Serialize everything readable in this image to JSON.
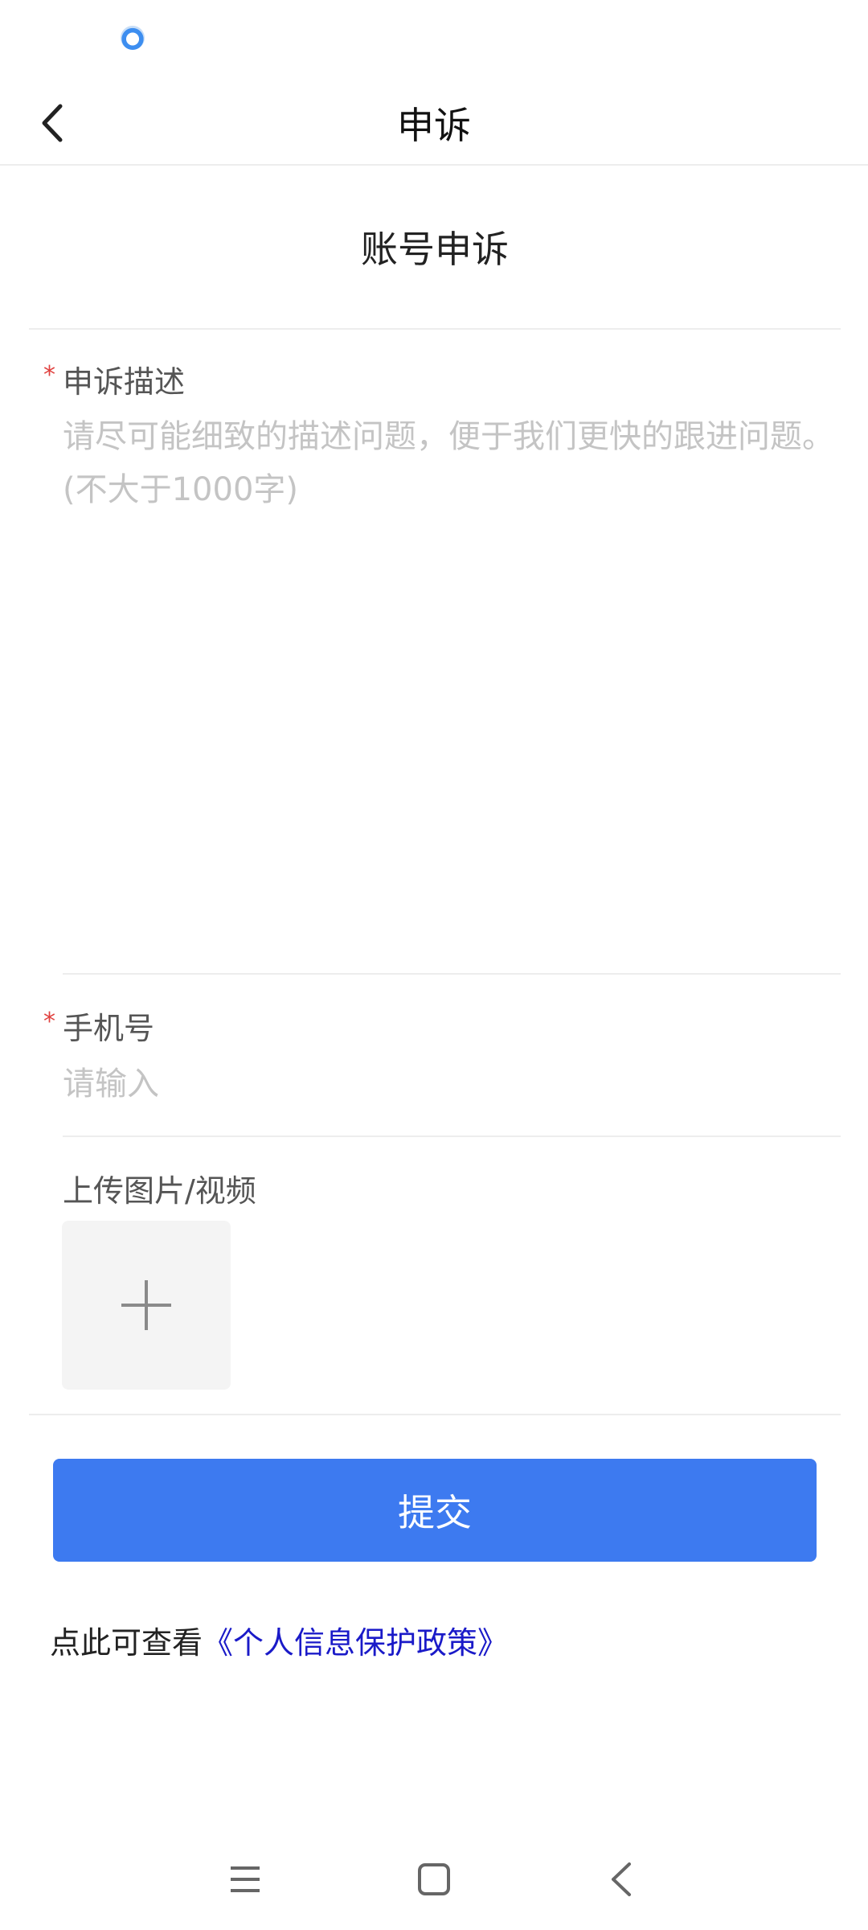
{
  "status_bar": {
    "icon": "app-notification-icon"
  },
  "nav": {
    "title": "申诉",
    "back_icon": "chevron-left-icon"
  },
  "section_title": "账号申诉",
  "form": {
    "description": {
      "label": "申诉描述",
      "required_mark": "*",
      "placeholder": "请尽可能细致的描述问题，便于我们更快的跟进问题。(不大于1000字)",
      "value": ""
    },
    "phone": {
      "label": "手机号",
      "required_mark": "*",
      "placeholder": "请输入",
      "value": ""
    },
    "upload": {
      "label": "上传图片/视频",
      "icon": "plus-icon"
    }
  },
  "submit_label": "提交",
  "policy": {
    "prefix": "点此可查看",
    "link_text": "《个人信息保护政策》"
  },
  "system_nav": {
    "menu_icon": "menu-icon",
    "home_icon": "home-square-icon",
    "back_icon": "back-triangle-icon"
  },
  "colors": {
    "accent": "#3d7af0",
    "required": "#e0413f",
    "link": "#1a1ac8",
    "placeholder": "#c4c4c4",
    "divider": "#ededed"
  }
}
